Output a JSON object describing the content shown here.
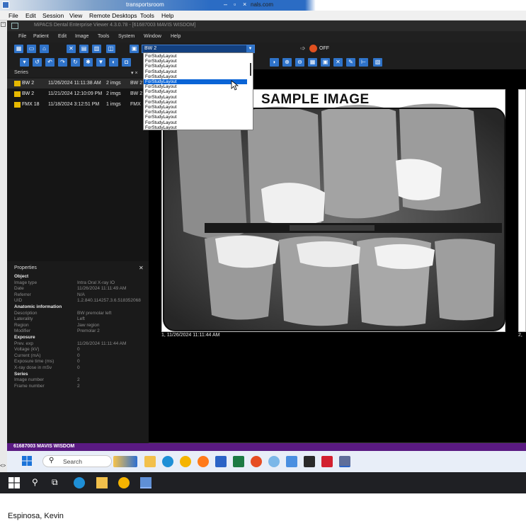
{
  "outer_window": {
    "title": "transportsroom",
    "url_fragment": "nals.com",
    "menu": [
      "File",
      "Edit",
      "Session",
      "View",
      "Remote Desktops",
      "Tools",
      "Help"
    ]
  },
  "app": {
    "title": "MiPACS Dental Enterprise Viewer 4.3.0.78 - [61687003 MAVIS WISDOM]",
    "menu": [
      "File",
      "Patient",
      "Edit",
      "Image",
      "Tools",
      "System",
      "Window",
      "Help"
    ],
    "layout_combo": {
      "value": "BW 2"
    },
    "indicator": {
      "label": "OFF",
      "color": "#e0501f"
    },
    "accent": "#2f73c9"
  },
  "layout_dropdown": {
    "items": [
      "ForStudyLayout",
      "ForStudyLayout",
      "ForStudyLayout",
      "ForStudyLayout",
      "ForStudyLayout",
      "ForStudyLayout",
      "ForStudyLayout",
      "ForStudyLayout",
      "ForStudyLayout",
      "ForStudyLayout",
      "ForStudyLayout",
      "ForStudyLayout",
      "ForStudyLayout",
      "ForStudyLayout",
      "ForStudyLayout"
    ],
    "selected_index": 5
  },
  "series": {
    "header": "Series",
    "rows": [
      {
        "name": "BW 2",
        "date": "11/26/2024 11:11:38 AM",
        "count": "2 imgs",
        "desc": "BW 2"
      },
      {
        "name": "BW 2",
        "date": "11/21/2024 12:10:09 PM",
        "count": "2 imgs",
        "desc": "BW 2"
      },
      {
        "name": "FMX 18",
        "date": "11/18/2024 3:12:51 PM",
        "count": "1 imgs",
        "desc": "FMX"
      }
    ]
  },
  "properties": {
    "title": "Properties",
    "lines": [
      {
        "key": "Object",
        "value": "",
        "section": true
      },
      {
        "key": "Image type",
        "value": "Intra Oral X-ray IO",
        "section": false
      },
      {
        "key": "Date",
        "value": "11/26/2024 11:11:49 AM",
        "section": false
      },
      {
        "key": "Referrer",
        "value": "N/A",
        "section": false
      },
      {
        "key": "UID",
        "value": "1.2.840.114257.3.6.518352068",
        "section": false
      },
      {
        "key": "Anatomic information",
        "value": "",
        "section": true
      },
      {
        "key": "Description",
        "value": "BW premolar left",
        "section": false
      },
      {
        "key": "Laterality",
        "value": "Left",
        "section": false
      },
      {
        "key": "Region",
        "value": "Jaw region",
        "section": false
      },
      {
        "key": "Modifier",
        "value": "Premolar 2",
        "section": false
      },
      {
        "key": "Exposure",
        "value": "",
        "section": true
      },
      {
        "key": "Prev. exp",
        "value": "11/26/2024 11:11:44 AM",
        "section": false
      },
      {
        "key": "Voltage (kV)",
        "value": "0",
        "section": false
      },
      {
        "key": "Current (mA)",
        "value": "0",
        "section": false
      },
      {
        "key": "Exposure time (ms)",
        "value": "0",
        "section": false
      },
      {
        "key": "X-ray dose in mSv",
        "value": "0",
        "section": false
      },
      {
        "key": "Series",
        "value": "",
        "section": true
      },
      {
        "key": "Image number",
        "value": "2",
        "section": false
      },
      {
        "key": "Frame number",
        "value": "2",
        "section": false
      }
    ]
  },
  "viewer": {
    "watermark": "SAMPLE IMAGE",
    "tile1_caption": "1, 11/26/2024 11:11:44 AM",
    "tile2_caption": "2,"
  },
  "status_bar": {
    "text": "61687003 MAVIS WISDOM",
    "color": "#5a1a82"
  },
  "inner_taskbar": {
    "search_placeholder": "Search"
  },
  "user_name": "Espinosa, Kevin"
}
